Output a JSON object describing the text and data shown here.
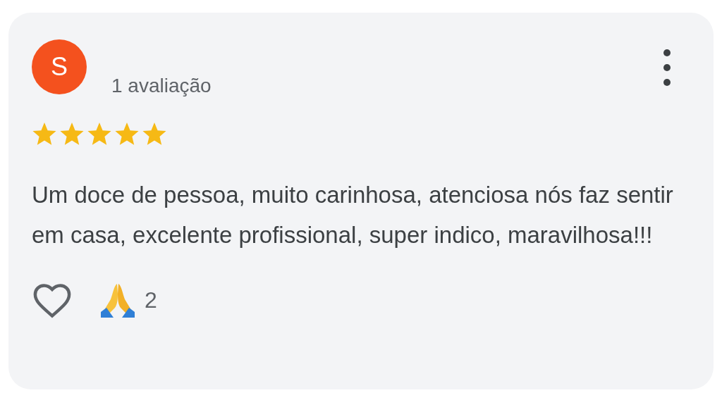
{
  "review": {
    "avatar_letter": "S",
    "review_count": "1 avaliação",
    "stars": 5,
    "text": "Um doce de pessoa, muito carinhosa, atenciosa nós faz sentir em casa, excelente profissional, super indico, maravilhosa!!!",
    "liked": false,
    "reaction_count": "2"
  }
}
